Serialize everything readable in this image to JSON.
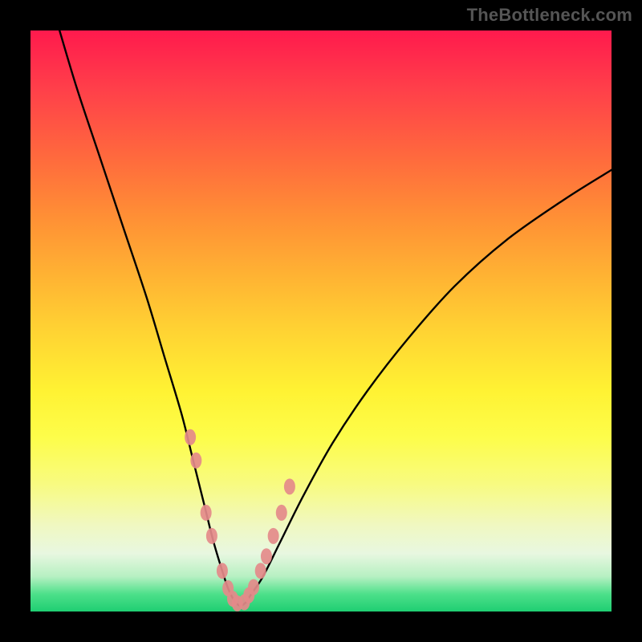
{
  "watermark": "TheBottleneck.com",
  "gradient_colors": {
    "top": "#ff1a4d",
    "mid_upper": "#ff8f35",
    "mid": "#fff233",
    "mid_lower": "#f0f8c0",
    "bottom": "#1fce72"
  },
  "chart_data": {
    "type": "line",
    "title": "",
    "xlabel": "",
    "ylabel": "",
    "xlim": [
      0,
      100
    ],
    "ylim": [
      0,
      100
    ],
    "series": [
      {
        "name": "curve",
        "x": [
          5,
          8,
          12,
          16,
          20,
          23,
          26,
          28,
          30,
          31.5,
          33,
          34,
          35,
          36,
          37,
          38,
          40,
          43,
          47,
          52,
          58,
          65,
          73,
          82,
          92,
          100
        ],
        "y": [
          100,
          90,
          78,
          66,
          54,
          44,
          34,
          26,
          18,
          12,
          7,
          4,
          2,
          1,
          1.5,
          3,
          6,
          12,
          20,
          29,
          38,
          47,
          56,
          64,
          71,
          76
        ]
      }
    ],
    "markers": {
      "name": "highlight-points",
      "color": "#e48a8a",
      "x": [
        27.5,
        28.5,
        30.2,
        31.2,
        33.0,
        34.0,
        34.8,
        35.6,
        36.8,
        37.6,
        38.4,
        39.6,
        40.6,
        41.8,
        43.2,
        44.6
      ],
      "y": [
        30.0,
        26.0,
        17.0,
        13.0,
        7.0,
        4.0,
        2.2,
        1.4,
        1.6,
        2.8,
        4.2,
        7.0,
        9.5,
        13.0,
        17.0,
        21.5
      ]
    }
  }
}
